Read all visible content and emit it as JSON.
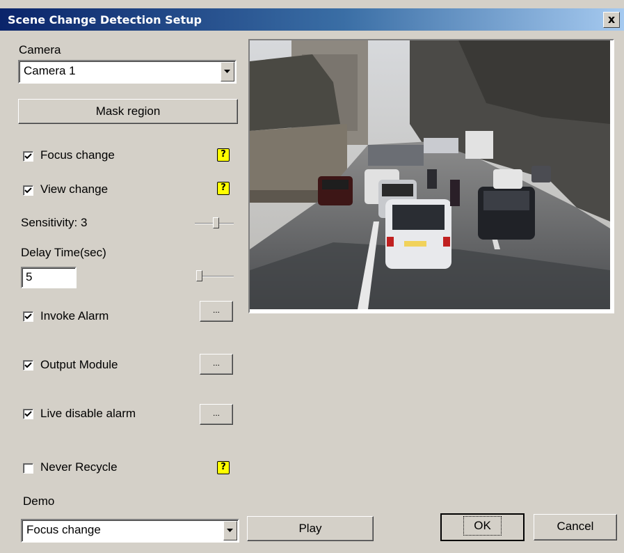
{
  "window": {
    "title": "Scene Change Detection Setup",
    "close": "x"
  },
  "camera": {
    "label": "Camera",
    "selected": "Camera 1"
  },
  "mask_button": "Mask region",
  "focus_change": {
    "label": "Focus change",
    "checked": true
  },
  "view_change": {
    "label": "View change",
    "checked": true
  },
  "sensitivity": {
    "label": "Sensitivity: 3",
    "value": 3
  },
  "delay": {
    "label": "Delay Time(sec)",
    "value": "5"
  },
  "invoke_alarm": {
    "label": "Invoke Alarm",
    "checked": true,
    "button": "..."
  },
  "output_module": {
    "label": "Output Module",
    "checked": true,
    "button": "..."
  },
  "live_disable": {
    "label": "Live disable alarm",
    "checked": true,
    "button": "..."
  },
  "never_recycle": {
    "label": "Never Recycle",
    "checked": false
  },
  "demo": {
    "label": "Demo",
    "selected": "Focus change",
    "play": "Play"
  },
  "footer": {
    "ok": "OK",
    "cancel": "Cancel"
  },
  "help_icon": "?",
  "colors": {
    "title_bg": "#0a246a",
    "dialog_bg": "#d4d0c8",
    "help_bg": "#ffff00"
  }
}
